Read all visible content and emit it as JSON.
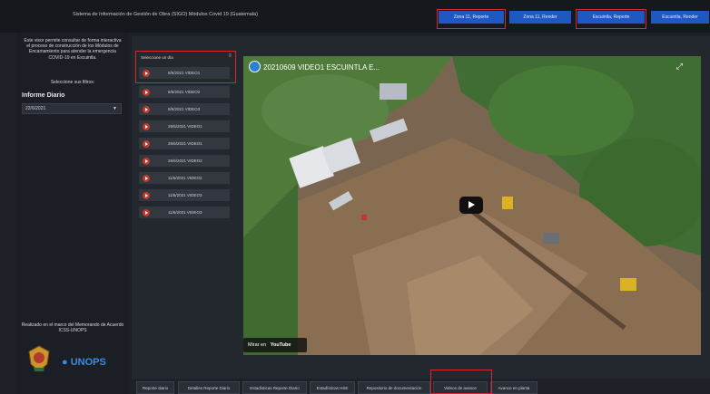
{
  "header": {
    "title": "Sistema de Información de Gestión de Obra (SIGO) Módulos Covid 19 (Guatemala)",
    "buttons": [
      "Zona 11, Reporte",
      "Zona 11, Render",
      "Escuintla, Reporte",
      "Escuintla, Render"
    ]
  },
  "sidebar": {
    "description": "Este visor permite consultar de forma interactiva el proceso de construcción de los Módulos de Encamamiento para atender la emergencia COVID-19 en Escuintla.",
    "filters_label": "Seleccione sus filtros:",
    "heading": "Informe Diario",
    "date_value": "22/6/2021",
    "footer": "Realizado en  el marco del Memorando de Acuerdo ICSS-UNOPS",
    "logo_text": "UNOPS"
  },
  "video_list": {
    "header": "Seleccione un día",
    "menu_icon": "hamburger-icon",
    "items": [
      "8/6/2021 VIDEO1",
      "8/6/2021 VIDEO2",
      "8/6/2021 VIDEO3",
      "28/5/2021 VIDEO1",
      "26/6/2021 VIDEO1",
      "26/6/2021 VIDEO2",
      "11/6/2021 VIDEO2",
      "11/6/2021 VIDEO3",
      "11/6/2021 VIDEO3"
    ]
  },
  "video": {
    "title": "20210609 VIDEO1 ESCUINTLA E...",
    "watch_on": "Mirar en",
    "youtube": "YouTube"
  },
  "tabs": [
    "Reporte diario",
    "Detalles Reporte Diario",
    "Estadísticas Reporte Diario",
    "Estadísticas HSE",
    "Repositorio de documentación",
    "Videos de avance",
    "Avance en planta"
  ],
  "colors": {
    "accent": "#1f57c3",
    "highlight": "#d8262a",
    "logo": "#3b8be3"
  }
}
